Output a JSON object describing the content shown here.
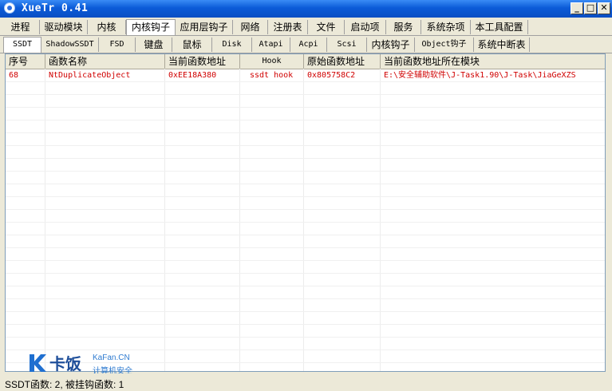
{
  "window": {
    "title": "XueTr 0.41"
  },
  "main_tabs": [
    "进程",
    "驱动模块",
    "内核",
    "内核钩子",
    "应用层钩子",
    "网络",
    "注册表",
    "文件",
    "启动项",
    "服务",
    "系统杂项",
    "本工具配置"
  ],
  "main_active": "内核钩子",
  "sub_tabs": [
    "SSDT",
    "ShadowSSDT",
    "FSD",
    "键盘",
    "鼠标",
    "Disk",
    "Atapi",
    "Acpi",
    "Scsi",
    "内核钩子",
    "Object钩子",
    "系统中断表"
  ],
  "sub_active": "SSDT",
  "table": {
    "columns": [
      "序号",
      "函数名称",
      "当前函数地址",
      "Hook",
      "原始函数地址",
      "当前函数地址所在模块"
    ],
    "rows": [
      [
        "68",
        "NtDuplicateObject",
        "0xEE18A380",
        "ssdt hook",
        "0x805758C2",
        "E:\\安全辅助软件\\J-Task1.90\\J-Task\\JiaGeXZS"
      ]
    ]
  },
  "status": {
    "text": "SSDT函数: 2, 被挂钩函数: 1"
  },
  "watermark": {
    "brand_cn": "卡饭",
    "brand_en": "KaFan.CN",
    "tagline": "计算机安全"
  },
  "colors": {
    "hooked_row": "#d00000",
    "titlebar": "#0b5bd8"
  }
}
